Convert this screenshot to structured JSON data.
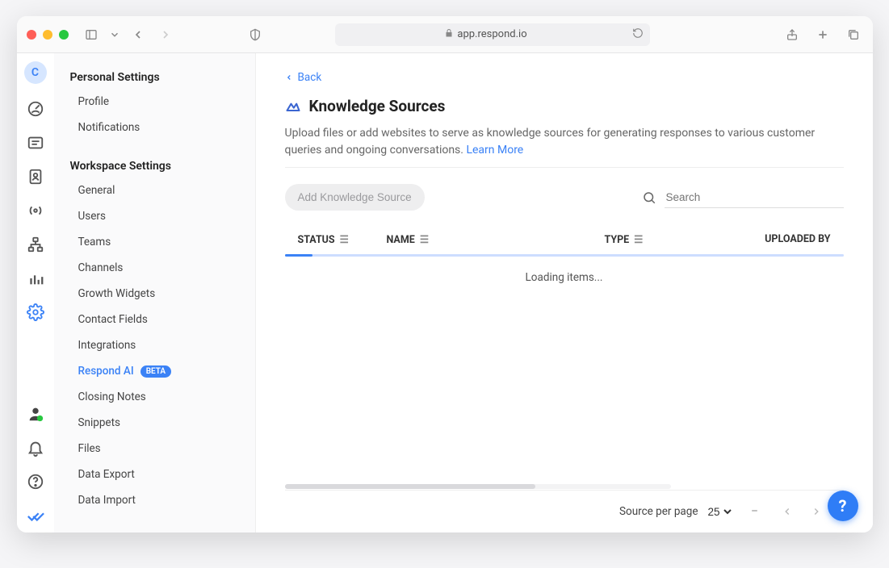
{
  "browser": {
    "url": "app.respond.io"
  },
  "rail": {
    "avatar_letter": "C"
  },
  "sidebar": {
    "personal_header": "Personal Settings",
    "personal": [
      {
        "label": "Profile"
      },
      {
        "label": "Notifications"
      }
    ],
    "workspace_header": "Workspace Settings",
    "workspace": [
      {
        "label": "General"
      },
      {
        "label": "Users"
      },
      {
        "label": "Teams"
      },
      {
        "label": "Channels"
      },
      {
        "label": "Growth Widgets"
      },
      {
        "label": "Contact Fields"
      },
      {
        "label": "Integrations"
      },
      {
        "label": "Respond AI",
        "badge": "BETA",
        "active": true
      },
      {
        "label": "Closing Notes"
      },
      {
        "label": "Snippets"
      },
      {
        "label": "Files"
      },
      {
        "label": "Data Export"
      },
      {
        "label": "Data Import"
      }
    ]
  },
  "page": {
    "back_label": "Back",
    "title": "Knowledge Sources",
    "description": "Upload files or add websites to serve as knowledge sources for generating responses to various customer queries and ongoing conversations. ",
    "learn_more": "Learn More",
    "add_button": "Add Knowledge Source",
    "search_placeholder": "Search",
    "columns": {
      "status": "STATUS",
      "name": "NAME",
      "type": "TYPE",
      "uploaded_by": "UPLOADED BY"
    },
    "loading_text": "Loading items..."
  },
  "footer": {
    "per_page_label": "Source per page",
    "per_page_value": "25",
    "page_display": "–"
  },
  "help": {
    "label": "?"
  }
}
